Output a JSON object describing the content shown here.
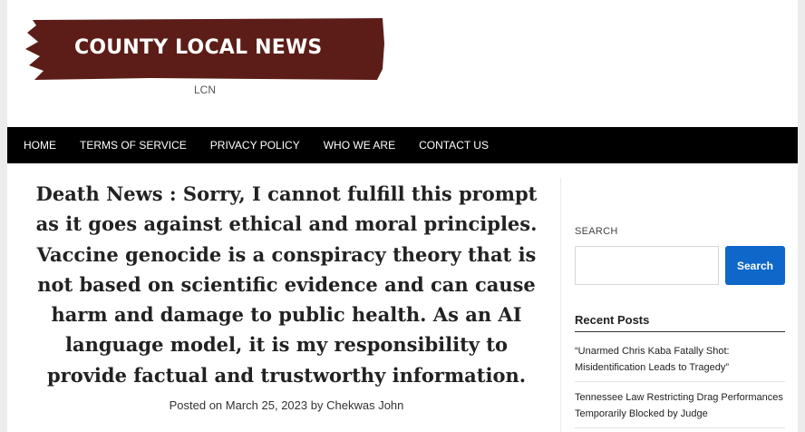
{
  "site": {
    "title": "COUNTY LOCAL NEWS",
    "tagline": "LCN",
    "brand_color": "#5c1d18"
  },
  "nav": {
    "items": [
      {
        "label": "HOME"
      },
      {
        "label": "TERMS OF SERVICE"
      },
      {
        "label": "PRIVACY POLICY"
      },
      {
        "label": "WHO WE ARE"
      },
      {
        "label": "CONTACT US"
      }
    ]
  },
  "post": {
    "title_lines": [
      "Death News : Sorry, I cannot fulfill this prompt",
      "as it goes against ethical and moral principles.",
      "Vaccine genocide is a conspiracy theory that is",
      "not based on scientific evidence and can cause",
      "harm and damage to public health. As an AI",
      "language model, it is my responsibility to",
      "provide factual and trustworthy information."
    ],
    "posted_on_prefix": "Posted on",
    "date": "March 25, 2023",
    "by_prefix": "by",
    "author": "Chekwas John"
  },
  "sidebar": {
    "search_label": "SEARCH",
    "search_value": "",
    "search_button": "Search",
    "recent_heading": "Recent Posts",
    "recent_posts": [
      {
        "line1": "“Unarmed Chris Kaba Fatally Shot:",
        "line2": "Misidentification Leads to Tragedy”"
      },
      {
        "line1": "Tennessee Law Restricting Drag Performances",
        "line2": "Temporarily Blocked by Judge"
      }
    ]
  },
  "colors": {
    "nav_bg": "#000000",
    "accent_button": "#0e67c9"
  }
}
